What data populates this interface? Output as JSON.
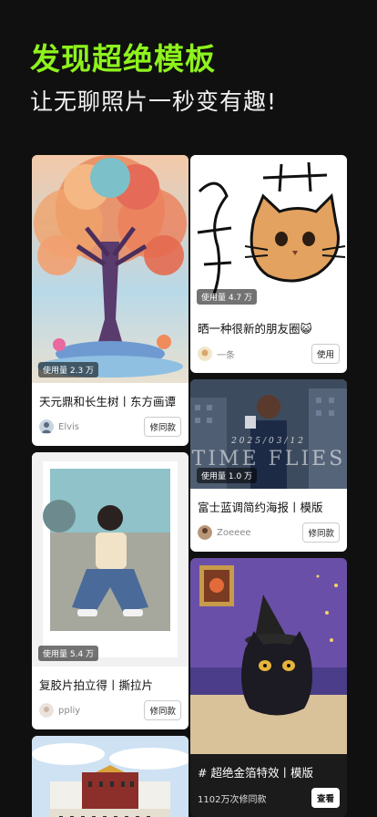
{
  "hero": {
    "title": "发现超绝模板",
    "subtitle": "让无聊照片一秒变有趣!"
  },
  "cards": {
    "tree": {
      "usage": "使用量 2.3 万",
      "title": "天元鼎和长生树丨东方画谭",
      "author": "Elvis",
      "button": "修同款"
    },
    "cat_drawing": {
      "glyph": "猫",
      "usage": "使用量 4.7 万",
      "title": "晒一种很新的朋友圈😺",
      "author": "一条",
      "button": "使用"
    },
    "blue_poster": {
      "date": "2025/03/12",
      "overlay": "TIME FLIES",
      "usage": "使用量 1.0 万",
      "title": "富士蓝调简约海报丨模版",
      "author": "Zoeeee",
      "button": "修同款"
    },
    "polaroid": {
      "usage": "使用量 5.4 万",
      "title": "复胶片拍立得丨撕拉片",
      "author": "ppliy",
      "button": "修同款"
    },
    "gold_cat": {
      "title": "# 超绝金箔特效丨模版",
      "count": "1102万次修同款",
      "button": "查看"
    }
  },
  "colors": {
    "accent": "#8ef21c",
    "background": "#0f100f"
  }
}
